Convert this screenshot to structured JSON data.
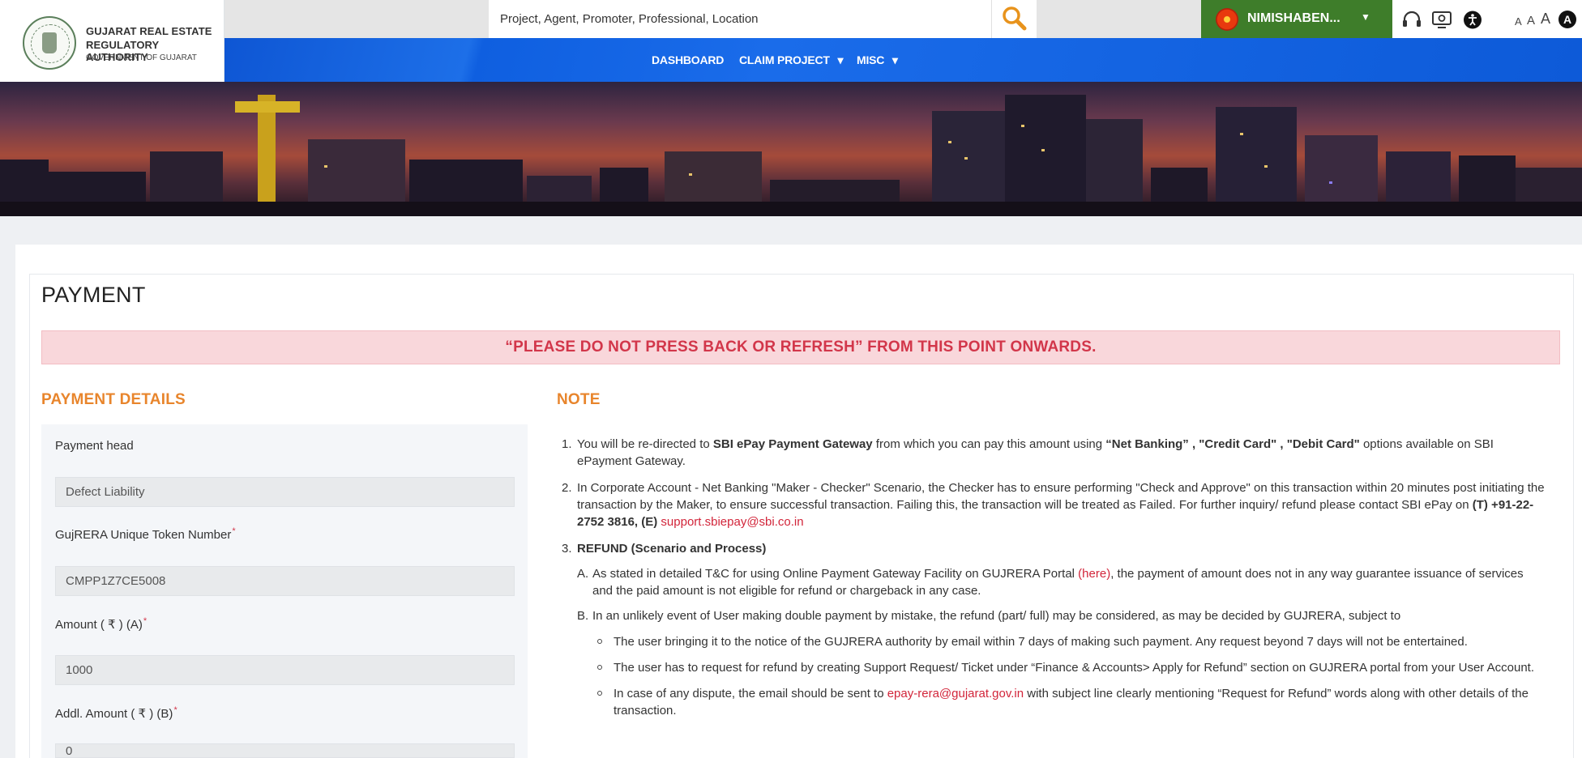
{
  "header": {
    "logo_line1": "GUJARAT REAL ESTATE",
    "logo_line2": "REGULATORY AUTHORITY",
    "logo_line3": "GOVERNMENT OF GUJARAT",
    "search_placeholder": "Project, Agent, Promoter, Professional, Location",
    "user_name": "NIMISHABEN...",
    "user_caret": "▼",
    "font_small": "A",
    "font_medium": "A",
    "font_large": "A",
    "font_dark": "A"
  },
  "nav": {
    "dashboard": "DASHBOARD",
    "claim_project": "CLAIM PROJECT",
    "misc": "MISC",
    "caret": "▾"
  },
  "page": {
    "title": "PAYMENT",
    "alert": "“PLEASE DO NOT PRESS BACK OR REFRESH” FROM THIS POINT ONWARDS."
  },
  "payment_details": {
    "heading": "PAYMENT DETAILS",
    "payment_head_label": "Payment head",
    "payment_head_value": "Defect Liability",
    "token_label": "GujRERA Unique Token Number",
    "token_value": "CMPP1Z7CE5008",
    "amount_label": "Amount ( ₹ ) (A)",
    "amount_value": "1000",
    "addl_amount_label": "Addl. Amount ( ₹ ) (B)",
    "addl_amount_value": "0",
    "required_mark": "*"
  },
  "note": {
    "heading": "NOTE",
    "n1_num": "1.",
    "n1_a": "You will be re-directed to ",
    "n1_b": "SBI ePay Payment Gateway",
    "n1_c": " from which you can pay this amount using ",
    "n1_d": "“Net Banking” , \"Credit Card\" , \"Debit Card\"",
    "n1_e": " options available on SBI ePayment Gateway.",
    "n2_num": "2.",
    "n2_a": "In Corporate Account - Net Banking \"Maker - Checker\" Scenario, the Checker has to ensure performing \"Check and Approve\" on this transaction within 20 minutes post initiating the transaction by the Maker, to ensure successful transaction. Failing this, the transaction will be treated as Failed. For further inquiry/ refund please contact SBI ePay on ",
    "n2_b": "(T) +91-22-2752 3816, (E)",
    "n2_email": "support.sbiepay@sbi.co.in",
    "n3_num": "3.",
    "n3_title": "REFUND (Scenario and Process)",
    "a_letter": "A.",
    "a_1": "As stated in detailed T&C for using Online Payment Gateway Facility on GUJRERA Portal ",
    "a_link": "(here)",
    "a_2": ", the payment of amount does not in any way guarantee issuance of services and the paid amount is not eligible for refund or chargeback in any case.",
    "b_letter": "B.",
    "b_1": "In an unlikely event of User making double payment by mistake, the refund (part/ full) may be considered, as may be decided by GUJRERA, subject to",
    "bullet1": "The user bringing it to the notice of the GUJRERA authority by email within 7 days of making such payment. Any request beyond 7 days will not be entertained.",
    "bullet2": "The user has to request for refund by creating Support Request/ Ticket under “Finance & Accounts> Apply for Refund” section on GUJRERA portal from your User Account.",
    "bullet3_a": "In case of any dispute, the email should be sent to ",
    "bullet3_email": "epay-rera@gujarat.gov.in",
    "bullet3_b": " with subject line clearly mentioning “Request for Refund” words along with other details of the transaction."
  },
  "colors": {
    "brand_green": "#3e7d2a",
    "nav_blue": "#1a6cea",
    "accent_orange": "#e8852c",
    "alert_red": "#d2364a"
  }
}
